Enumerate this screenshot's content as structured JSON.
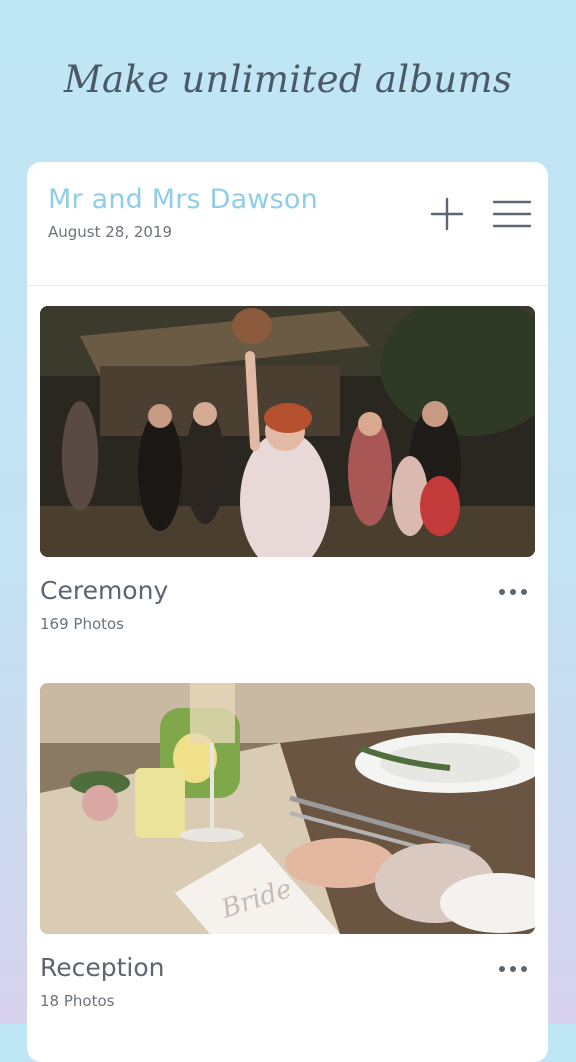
{
  "headline": "Make unlimited albums",
  "album": {
    "title": "Mr and Mrs Dawson",
    "date": "August 28, 2019"
  },
  "header_icons": {
    "add": "plus-icon",
    "menu": "hamburger-menu-icon"
  },
  "sections": [
    {
      "title": "Ceremony",
      "count": "169 Photos",
      "photo": "bride-bouquet-toss-photo"
    },
    {
      "title": "Reception",
      "count": "18 Photos",
      "photo": "reception-table-setting-photo"
    }
  ],
  "colors": {
    "background_top": "#bfe6f5",
    "background_bottom": "#d8d2ee",
    "album_title": "#8fcdea",
    "headline": "#4c5a68",
    "icon": "#5c6670"
  }
}
